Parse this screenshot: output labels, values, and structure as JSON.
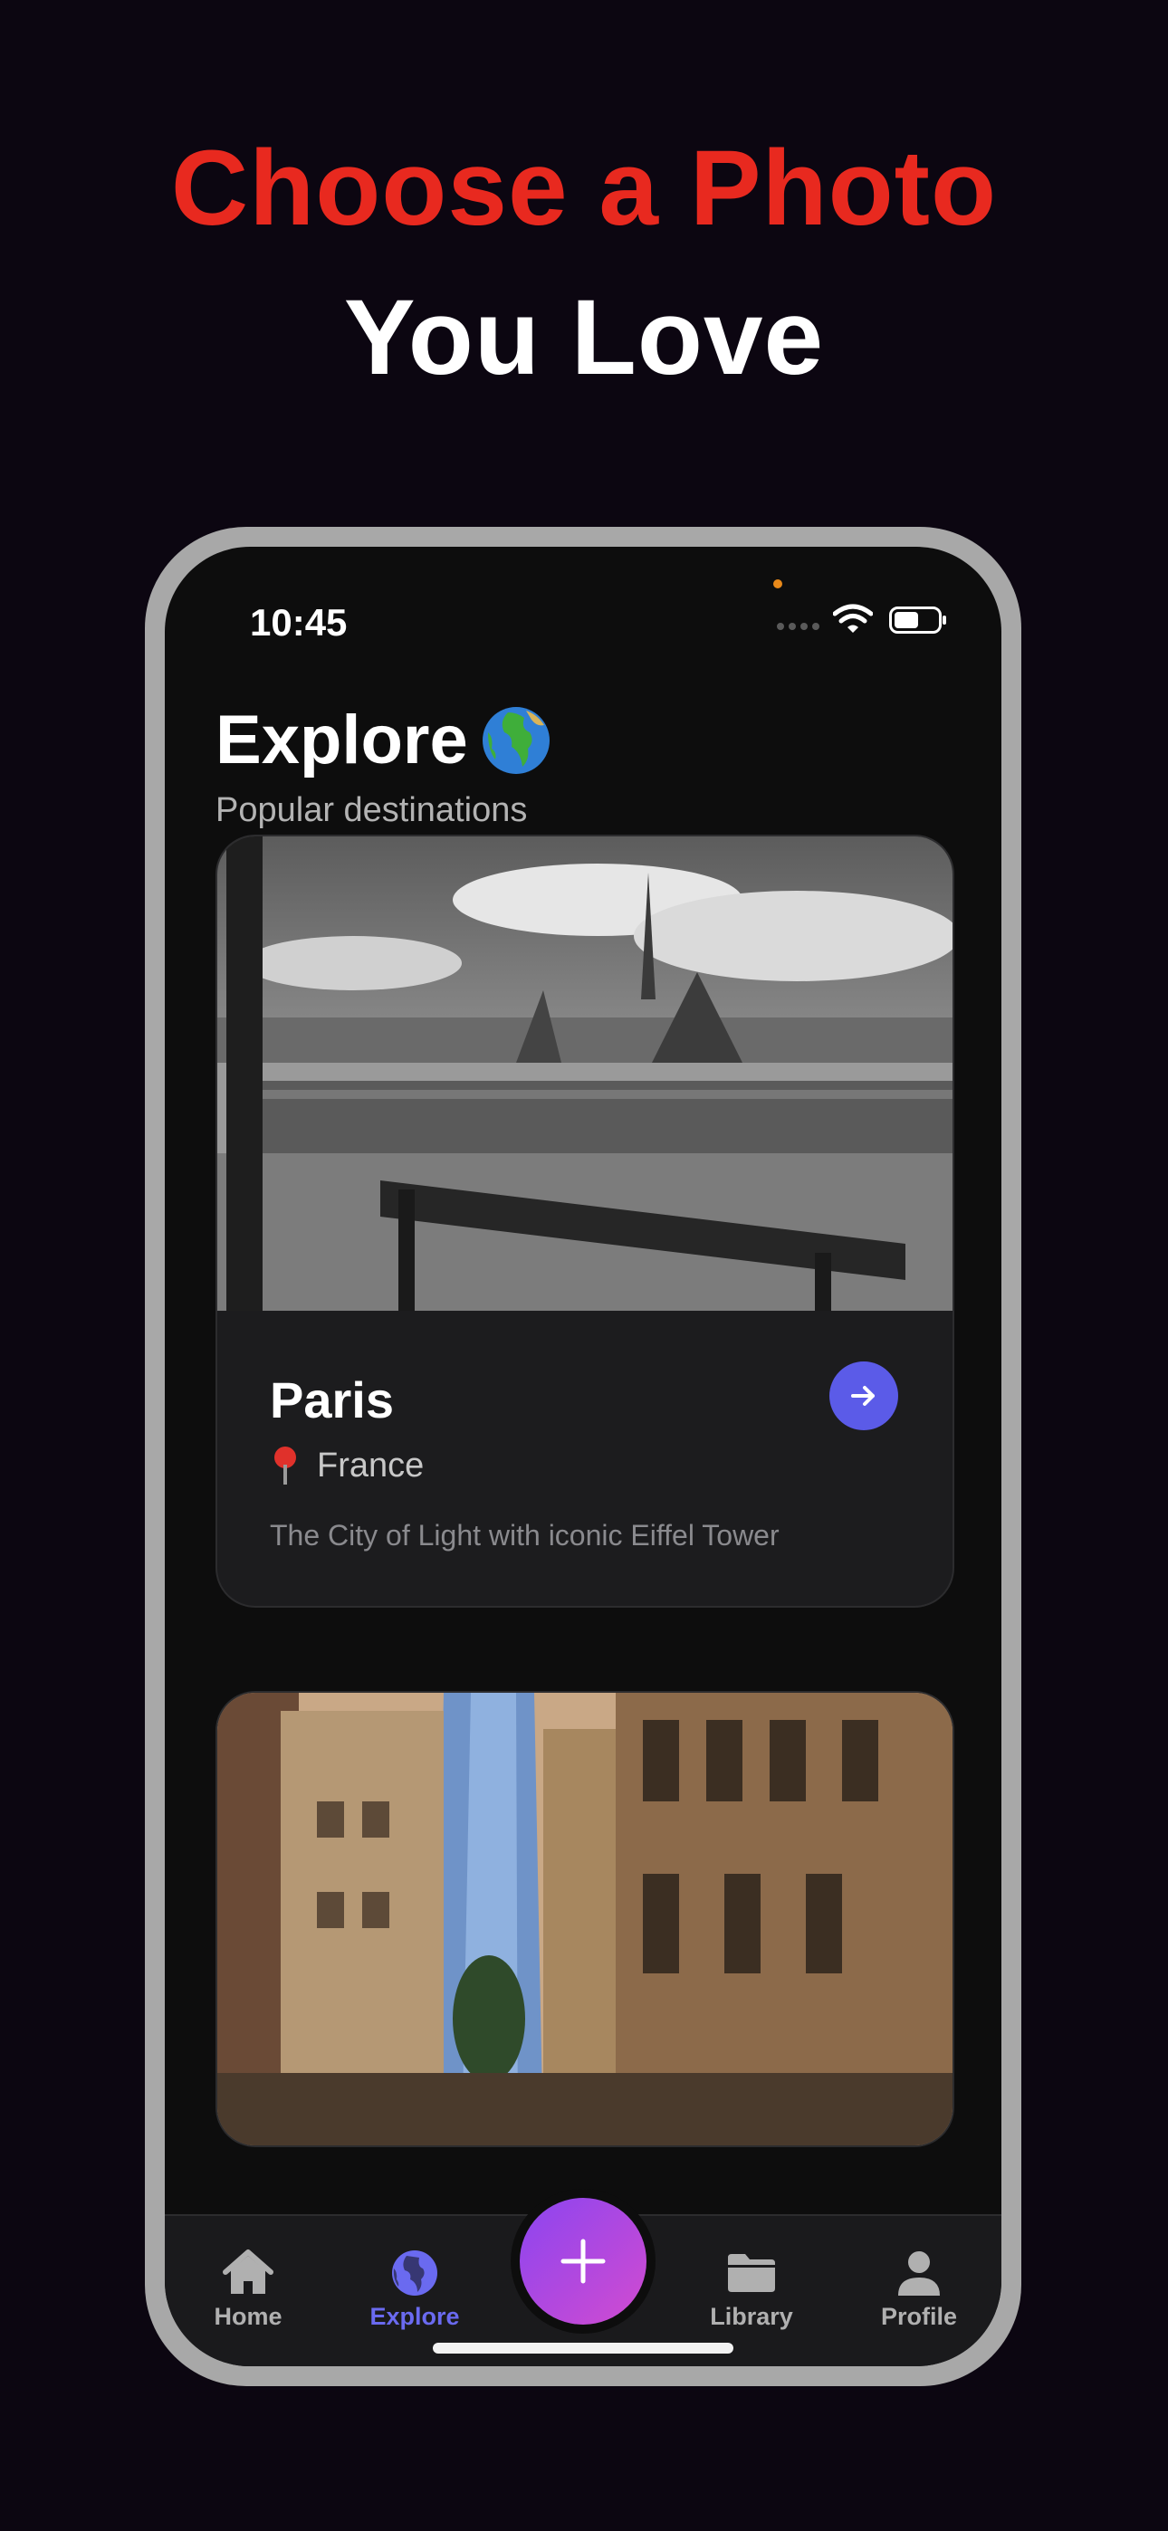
{
  "headline": {
    "line1": "Choose a Photo",
    "line2": "You Love"
  },
  "status_bar": {
    "time": "10:45"
  },
  "screen": {
    "title": "Explore",
    "subtitle": "Popular destinations"
  },
  "cards": [
    {
      "name": "Paris",
      "country": "France",
      "description": "The City of Light with iconic Eiffel Tower"
    }
  ],
  "tabbar": {
    "items": [
      {
        "label": "Home",
        "icon": "house-icon",
        "active": false
      },
      {
        "label": "Explore",
        "icon": "globe-icon",
        "active": true
      },
      {
        "label": "Library",
        "icon": "folder-icon",
        "active": false
      },
      {
        "label": "Profile",
        "icon": "person-icon",
        "active": false
      }
    ],
    "fab_icon": "plus-icon"
  },
  "colors": {
    "accent": "#5b5be8",
    "headline_red": "#e8291f",
    "fab_start": "#8b45f0",
    "fab_end": "#d24bd0"
  }
}
